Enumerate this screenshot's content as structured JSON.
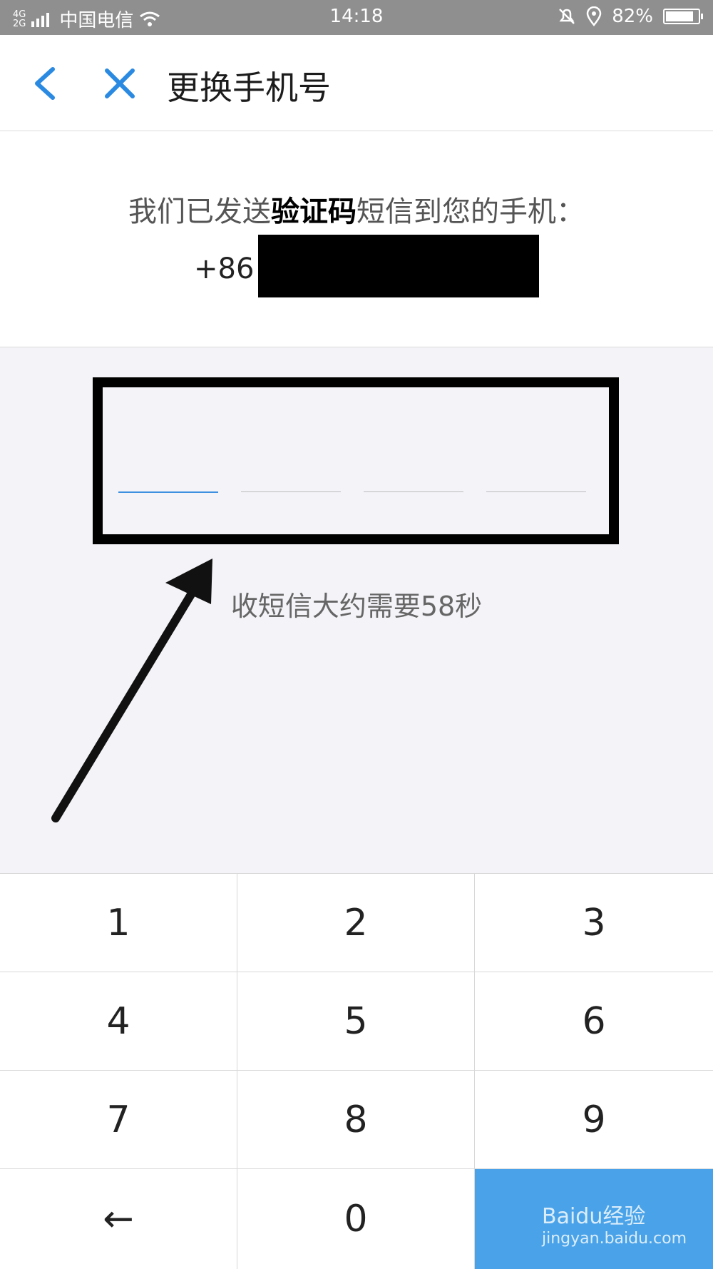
{
  "status_bar": {
    "network": [
      "4G",
      "2G"
    ],
    "carrier": "中国电信",
    "time": "14:18",
    "battery": "82%"
  },
  "header": {
    "title": "更换手机号"
  },
  "info": {
    "message_part1": "我们已发送",
    "message_bold": "验证码",
    "message_part2": "短信到您的手机：",
    "country_code": "+86"
  },
  "code": {
    "hint": "收短信大约需要58秒"
  },
  "keypad": {
    "keys": [
      "1",
      "2",
      "3",
      "4",
      "5",
      "6",
      "7",
      "8",
      "9",
      "←",
      "0"
    ]
  },
  "watermark": {
    "brand": "Baidu经验",
    "url": "jingyan.baidu.com"
  },
  "colors": {
    "accent": "#3d8fe0",
    "confirm_key": "#4aa3e8",
    "code_area_bg": "#f3f3f8"
  }
}
